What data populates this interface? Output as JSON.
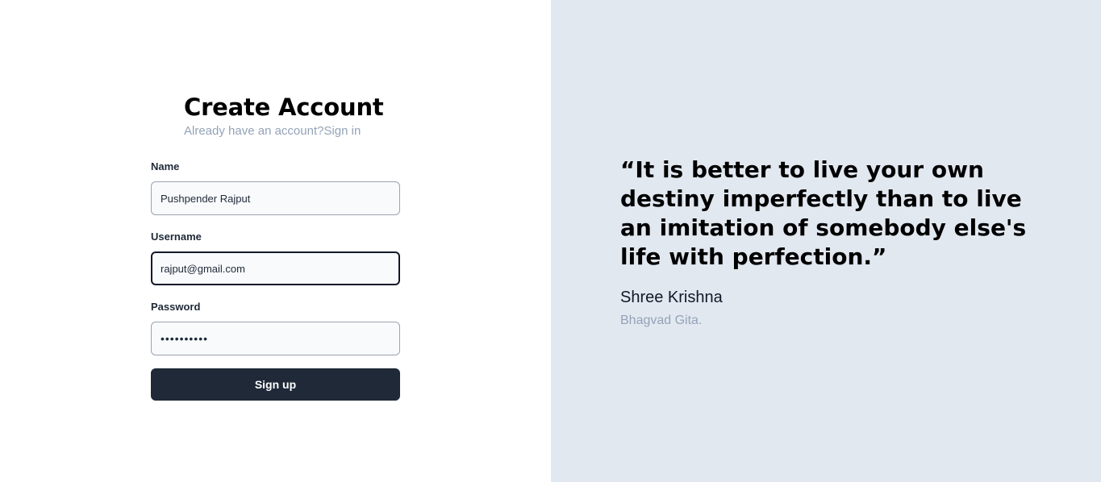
{
  "signup": {
    "title": "Create Account",
    "already_text": "Already have an account?",
    "signin_link": "Sign in",
    "name_label": "Name",
    "name_value": "Pushpender Rajput",
    "username_label": "Username",
    "username_value": "rajput@gmail.com",
    "password_label": "Password",
    "password_value": "••••••••••",
    "submit_label": "Sign up"
  },
  "quote": {
    "text": "“It is better to live your own destiny imperfectly than to live an imitation of somebody else's life with perfection.”",
    "author": "Shree Krishna",
    "source": "Bhagvad Gita."
  },
  "colors": {
    "right_panel_bg": "#e2e8f0",
    "button_bg": "#1f2937",
    "muted_text": "#94a3b8"
  }
}
